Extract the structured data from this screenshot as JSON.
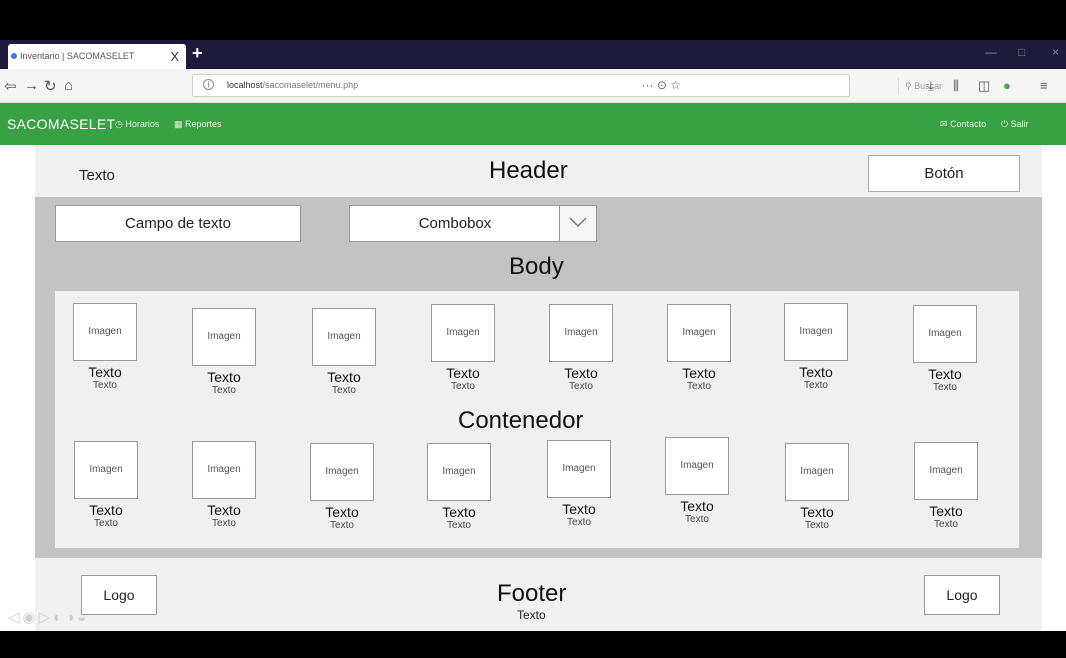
{
  "browser": {
    "tab_title": "Inventario | SACOMASELET",
    "tab_close": "X",
    "new_tab": "+",
    "url_host": "localhost",
    "url_path": "/sacomaselet/menu.php",
    "url_actions": "··· ⊙ ☆",
    "search_placeholder": "Buscar",
    "tools": [
      "⤓",
      "⫼",
      "◫",
      "●",
      "≡"
    ]
  },
  "app": {
    "brand": "SACOMASELET",
    "nav_left": [
      "Horarios",
      "Reportes"
    ],
    "nav_right": [
      "Contacto",
      "Salir"
    ],
    "accent": "#37a143"
  },
  "header": {
    "text": "Texto",
    "title": "Header",
    "button": "Botón"
  },
  "body": {
    "text_field": "Campo de texto",
    "combobox": "Combobox",
    "title": "Body"
  },
  "container": {
    "title": "Contenedor",
    "row1": [
      {
        "image": "Imagen",
        "title": "Texto",
        "subtitle": "Texto"
      },
      {
        "image": "Imagen",
        "title": "Texto",
        "subtitle": "Texto"
      },
      {
        "image": "Imagen",
        "title": "Texto",
        "subtitle": "Texto"
      },
      {
        "image": "Imagen",
        "title": "Texto",
        "subtitle": "Texto"
      },
      {
        "image": "Imagen",
        "title": "Texto",
        "subtitle": "Texto"
      },
      {
        "image": "Imagen",
        "title": "Texto",
        "subtitle": "Texto"
      },
      {
        "image": "Imagen",
        "title": "Texto",
        "subtitle": "Texto"
      },
      {
        "image": "Imagen",
        "title": "Texto",
        "subtitle": "Texto"
      }
    ],
    "row2": [
      {
        "image": "Imagen",
        "title": "Texto",
        "subtitle": "Texto"
      },
      {
        "image": "Imagen",
        "title": "Texto",
        "subtitle": "Texto"
      },
      {
        "image": "Imagen",
        "title": "Texto",
        "subtitle": "Texto"
      },
      {
        "image": "Imagen",
        "title": "Texto",
        "subtitle": "Texto"
      },
      {
        "image": "Imagen",
        "title": "Texto",
        "subtitle": "Texto"
      },
      {
        "image": "Imagen",
        "title": "Texto",
        "subtitle": "Texto"
      },
      {
        "image": "Imagen",
        "title": "Texto",
        "subtitle": "Texto"
      },
      {
        "image": "Imagen",
        "title": "Texto",
        "subtitle": "Texto"
      }
    ]
  },
  "footer": {
    "logo_left": "Logo",
    "logo_right": "Logo",
    "title": "Footer",
    "text": "Texto"
  }
}
